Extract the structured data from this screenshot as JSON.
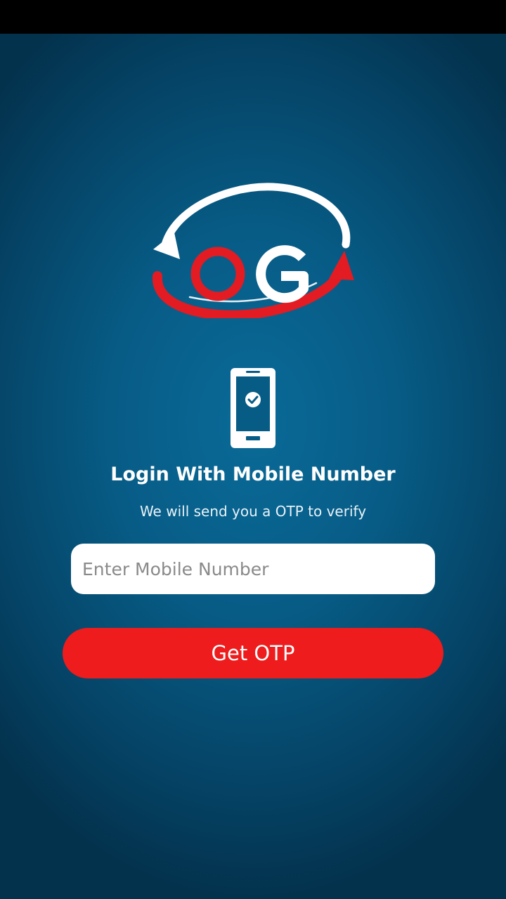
{
  "logo": {
    "text": "OG",
    "colors": {
      "red": "#e31b23",
      "white": "#ffffff"
    }
  },
  "icons": {
    "phone": "phone-verified-icon"
  },
  "login": {
    "title": "Login With Mobile Number",
    "subtitle": "We will send you a OTP to verify"
  },
  "mobile_input": {
    "placeholder": "Enter Mobile Number",
    "value": ""
  },
  "otp_button": {
    "label": "Get OTP"
  },
  "colors": {
    "background": "#075c86",
    "accent": "#ee1c1c",
    "text": "#ffffff"
  }
}
